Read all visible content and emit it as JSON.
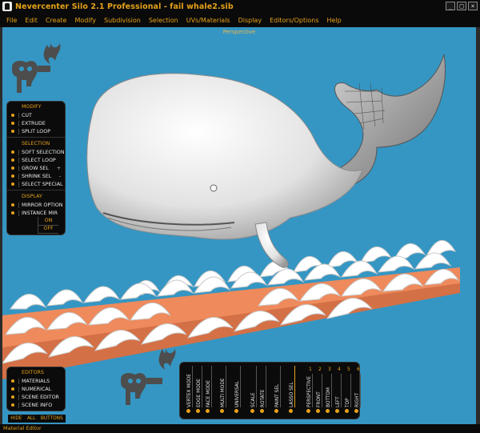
{
  "window": {
    "title": "Nevercenter Silo 2.1 Professional - fail whale2.sib",
    "controls": [
      "_",
      "□",
      "×"
    ]
  },
  "menu": [
    "File",
    "Edit",
    "Create",
    "Modify",
    "Subdivision",
    "Selection",
    "UVs/Materials",
    "Display",
    "Editors/Options",
    "Help"
  ],
  "viewport": {
    "label": "Perspective"
  },
  "panel": {
    "modify": {
      "title": "MODIFY",
      "items": [
        "CUT",
        "EXTRUDE",
        "SPLIT LOOP"
      ]
    },
    "selection": {
      "title": "SELECTION",
      "items": [
        "SOFT SELECTION",
        "SELECT LOOP",
        "GROW SEL",
        "SHRINK SEL",
        "SELECT SPECIAL"
      ]
    },
    "display": {
      "title": "DISPLAY",
      "items": [
        "MIRROR OPTION",
        "INSTANCE MIR"
      ],
      "on": "ON",
      "off": "OFF"
    }
  },
  "editors": {
    "title": "EDITORS",
    "items": [
      "MATERIALS",
      "NUMERICAL",
      "SCENE EDITOR",
      "SCENE INFO"
    ]
  },
  "hide_bar": {
    "hide": "HIDE",
    "all": "ALL",
    "buttons": "BUTTONS"
  },
  "modes": {
    "columns": [
      "VERTEX MODE",
      "EDGE MODE",
      "FACE MODE",
      "MULTI MODE",
      "UNIVERSAL",
      "SCALE",
      "ROTATE",
      "PAINT SEL",
      "LASSO SEL",
      "PERSPECTIVE",
      "FRONT",
      "BOTTOM",
      "LEFT",
      "TOP",
      "RIGHT"
    ],
    "view_numbers": [
      "1",
      "2",
      "3",
      "4",
      "5",
      "6"
    ]
  },
  "status": {
    "text": "Material Editor"
  },
  "colors": {
    "accent": "#e6a21a",
    "viewport_bg": "#3596c3",
    "wave_orange": "#ee8a5c",
    "whale": "#f0f0f0",
    "logo": "#4d4d4d"
  }
}
